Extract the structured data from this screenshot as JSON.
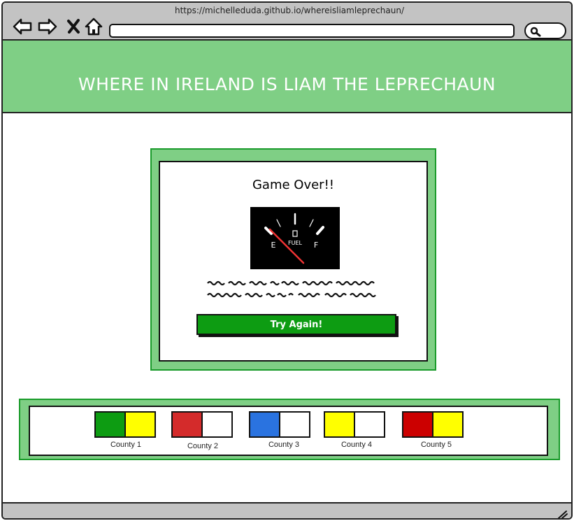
{
  "browser": {
    "url": "https://michelleduda.github.io/whereisliamleprechaun/",
    "icons": [
      "back-arrow-icon",
      "forward-arrow-icon",
      "close-icon",
      "home-icon",
      "search-icon",
      "resize-grip-icon"
    ]
  },
  "header": {
    "title": "WHERE IN IRELAND IS LIAM THE LEPRECHAUN",
    "background": "#7fcf85"
  },
  "modal": {
    "title": "Game Over!!",
    "gauge": {
      "empty_label": "E",
      "full_label": "F",
      "fuel_label": "FUEL",
      "level": 0
    },
    "button_label": "Try Again!",
    "button_color": "#0d9c12"
  },
  "counties": [
    {
      "label": "County 1",
      "colors": [
        "#0d9c12",
        "#ffff00"
      ]
    },
    {
      "label": "County 2",
      "colors": [
        "#d42b2b",
        "#ffffff"
      ]
    },
    {
      "label": "County 3",
      "colors": [
        "#2a73e0",
        "#ffffff"
      ]
    },
    {
      "label": "County 4",
      "colors": [
        "#ffff00",
        "#ffffff"
      ]
    },
    {
      "label": "County 5",
      "colors": [
        "#cc0000",
        "#ffff00"
      ]
    }
  ]
}
